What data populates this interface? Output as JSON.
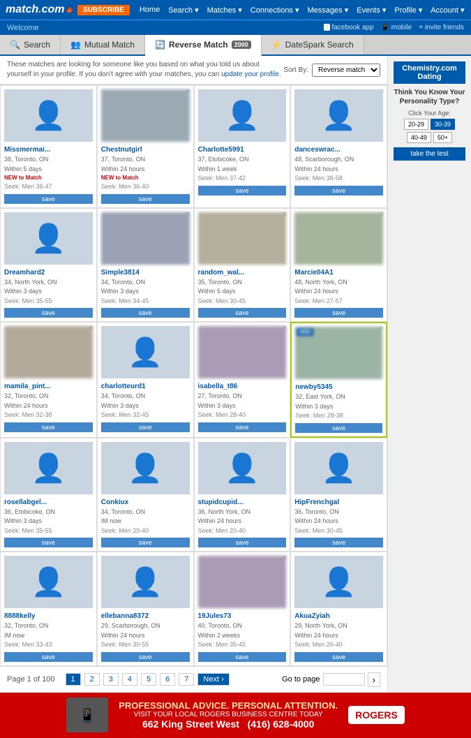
{
  "header": {
    "logo": "match.com",
    "logo_dot": ".",
    "subscribe_label": "SUBSCRIBE",
    "nav_items": [
      "Home",
      "Search ▾",
      "Matches ▾",
      "Connections ▾",
      "Messages ▾",
      "Events ▾",
      "Profile ▾",
      "Account ▾"
    ]
  },
  "subheader": {
    "welcome": "Welcome",
    "facebook_label": "facebook app",
    "mobile_label": "mobile",
    "invite_label": "invite friends"
  },
  "tabs": [
    {
      "id": "search",
      "label": "Search",
      "icon": "🔍",
      "active": false
    },
    {
      "id": "mutual",
      "label": "Mutual Match",
      "icon": "👥",
      "active": false
    },
    {
      "id": "reverse",
      "label": "Reverse Match",
      "icon": "🔄",
      "active": true,
      "badge": "2000"
    },
    {
      "id": "datespark",
      "label": "DateSpark Search",
      "icon": "⚡",
      "active": false
    }
  ],
  "info_bar": {
    "text": "These matches are looking for someone like you based on what you told us about yourself in your profile. If you don't agree with your matches, you can",
    "link_text": "update your profile.",
    "sort_label": "Sort By:",
    "sort_value": "Reverse match"
  },
  "matches": [
    {
      "name": "Missmermai...",
      "age": "38",
      "location": "Toronto, ON",
      "online": "Within 5 days",
      "status": "NEW to Match",
      "seek": "Seek: Men 36-47",
      "has_photo": false,
      "highlighted": false
    },
    {
      "name": "Chestnutgirl",
      "age": "37",
      "location": "Toronto, ON",
      "online": "Within 24 hours",
      "status": "NEW to Match",
      "seek": "Seek: Men 36-40",
      "has_photo": true,
      "highlighted": false
    },
    {
      "name": "Charlotte5991",
      "age": "37",
      "location": "Etobicoke, ON",
      "online": "Within 1 week",
      "status": "",
      "seek": "Seek: Men 37-42",
      "has_photo": false,
      "highlighted": false
    },
    {
      "name": "danceswrac...",
      "age": "48",
      "location": "Scarborough, ON",
      "online": "Within 24 hours",
      "status": "",
      "seek": "Seek: Men 38-58",
      "has_photo": false,
      "highlighted": false
    },
    {
      "name": "Dreamhard2",
      "age": "34",
      "location": "North York, ON",
      "online": "Within 3 days",
      "status": "",
      "seek": "Seek: Men 35-55",
      "has_photo": false,
      "highlighted": false
    },
    {
      "name": "Simple3814",
      "age": "34",
      "location": "Toronto, ON",
      "online": "Within 3 days",
      "status": "",
      "seek": "Seek: Men 34-45",
      "has_photo": true,
      "highlighted": false
    },
    {
      "name": "random_wal...",
      "age": "35",
      "location": "Toronto, ON",
      "online": "Within 5 days",
      "status": "",
      "seek": "Seek: Men 30-45",
      "has_photo": true,
      "highlighted": false
    },
    {
      "name": "Marcie04A1",
      "age": "48",
      "location": "North York, ON",
      "online": "Within 24 hours",
      "status": "",
      "seek": "Seek: Men 27-57",
      "has_photo": true,
      "highlighted": false
    },
    {
      "name": "mamila_pint...",
      "age": "32",
      "location": "Toronto, ON",
      "online": "Within 24 hours",
      "status": "",
      "seek": "Seek: Men 32-38",
      "has_photo": true,
      "highlighted": false
    },
    {
      "name": "charlotteurd1",
      "age": "34",
      "location": "Toronto, ON",
      "online": "Within 3 days",
      "status": "",
      "seek": "Seek: Men 32-45",
      "has_photo": false,
      "highlighted": false
    },
    {
      "name": "isabella_t86",
      "age": "27",
      "location": "Toronto, ON",
      "online": "Within 3 days",
      "status": "",
      "seek": "Seek: Men 28-40",
      "has_photo": true,
      "highlighted": false
    },
    {
      "name": "newby5345",
      "age": "32",
      "location": "East York, ON",
      "online": "Within 3 days",
      "status": "",
      "seek": "Seek: Men 28-38",
      "has_photo": true,
      "highlighted": true
    },
    {
      "name": "rosellabgel...",
      "age": "36",
      "location": "Etobicoke, ON",
      "online": "Within 3 days",
      "status": "",
      "seek": "Seek: Men 35-55",
      "has_photo": false,
      "highlighted": false
    },
    {
      "name": "Conkiux",
      "age": "34",
      "location": "Toronto, ON",
      "online": "IM now",
      "status": "",
      "seek": "Seek: Men 29-40",
      "has_photo": false,
      "highlighted": false
    },
    {
      "name": "stupidcupid...",
      "age": "36",
      "location": "North York, ON",
      "online": "Within 24 hours",
      "status": "",
      "seek": "Seek: Men 20-40",
      "has_photo": false,
      "highlighted": false
    },
    {
      "name": "HipFrenchgal",
      "age": "36",
      "location": "Toronto, ON",
      "online": "Within 24 hours",
      "status": "",
      "seek": "Seek: Men 30-45",
      "has_photo": false,
      "highlighted": false
    },
    {
      "name": "8888kelly",
      "age": "32",
      "location": "Toronto, ON",
      "online": "IM now",
      "status": "",
      "seek": "Seek: Men 33-43",
      "has_photo": false,
      "highlighted": false
    },
    {
      "name": "ellebanna8372",
      "age": "29",
      "location": "Scarborough, ON",
      "online": "Within 24 hours",
      "status": "",
      "seek": "Seek: Men 30-55",
      "has_photo": false,
      "highlighted": false
    },
    {
      "name": "19Jules73",
      "age": "40",
      "location": "Toronto, ON",
      "online": "Within 2 weeks",
      "status": "",
      "seek": "Seek: Men 35-45",
      "has_photo": true,
      "highlighted": false
    },
    {
      "name": "AkuaZyiah",
      "age": "29",
      "location": "North York, ON",
      "online": "Within 24 hours",
      "status": "",
      "seek": "Seek: Men 26-40",
      "has_photo": false,
      "highlighted": false
    }
  ],
  "pagination": {
    "page_info": "Page 1 of 100",
    "pages": [
      "1",
      "2",
      "3",
      "4",
      "5",
      "6",
      "7"
    ],
    "current_page": "1",
    "next_label": "Next ›",
    "goto_label": "Go to page",
    "goto_arrow": "›"
  },
  "sidebar": {
    "title": "Chemistry.com Dating",
    "question": "Think You Know Your Personality Type?",
    "age_label": "Click Your Age:",
    "age_options": [
      "20-29",
      "30-39",
      "40-49",
      "50+"
    ],
    "test_button": "take the test"
  },
  "ad": {
    "headline": "PROFESSIONAL ADVICE. PERSONAL ATTENTION.",
    "subtext": "VISIT YOUR LOCAL ROGERS BUSINESS CENTRE TODAY",
    "address": "662 King Street West",
    "phone": "(416) 628-4000",
    "brand": "ROGERS"
  },
  "buttons": {
    "save_label": "save"
  }
}
